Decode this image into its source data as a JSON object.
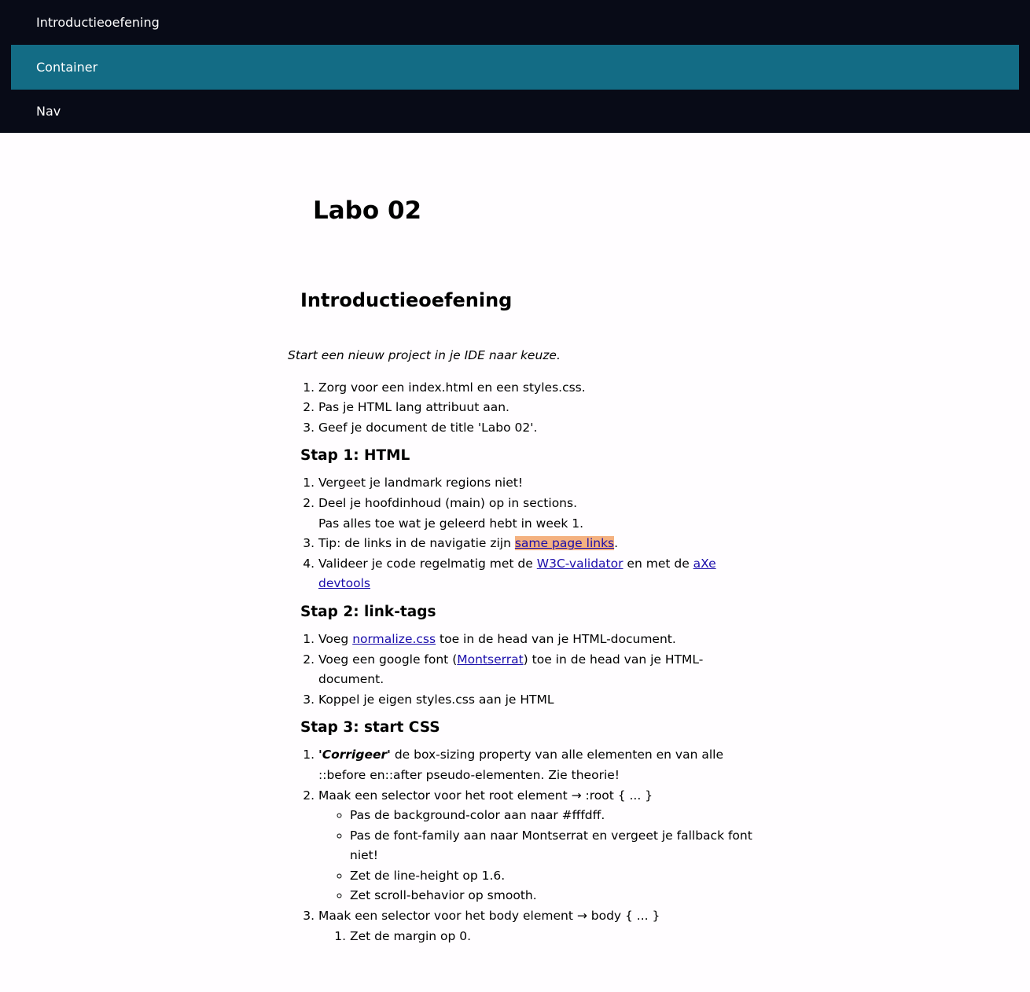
{
  "nav": {
    "items": [
      {
        "label": "Introductieoefening"
      },
      {
        "label": "Container"
      },
      {
        "label": "Nav"
      }
    ]
  },
  "page_title": "Labo 02",
  "section_title": "Introductieoefening",
  "intro": "Start een nieuw project in je IDE naar keuze.",
  "list_intro": [
    "Zorg voor een index.html en een styles.css.",
    "Pas je HTML lang attribuut aan.",
    "Geef je document de title 'Labo 02'."
  ],
  "step1": {
    "title": "Stap 1: HTML",
    "item1": "Vergeet je landmark regions niet!",
    "item2_line1": "Deel je hoofdinhoud (main) op in sections.",
    "item2_line2": "Pas alles toe wat je geleerd hebt in week 1.",
    "item3_prefix": "Tip: de links in de navigatie zijn ",
    "item3_link": "same page links",
    "item3_suffix": ".",
    "item4_prefix": "Valideer je code regelmatig met de ",
    "item4_link1": "W3C-validator",
    "item4_mid": " en met de ",
    "item4_link2": "aXe devtools"
  },
  "step2": {
    "title": "Stap 2: link-tags",
    "item1_prefix": "Voeg ",
    "item1_link": "normalize.css",
    "item1_suffix": " toe in de head van je HTML-document.",
    "item2_prefix": "Voeg een google font (",
    "item2_link": "Montserrat",
    "item2_suffix": ") toe in de head van je HTML-document.",
    "item3": "Koppel je eigen styles.css aan je HTML"
  },
  "step3": {
    "title": "Stap 3: start CSS",
    "item1_strong": "'Corrigeer'",
    "item1_rest": " de box-sizing property van alle elementen en van alle ::before en::after pseudo-elementen. Zie theorie!",
    "item2": "Maak een selector voor het root element → :root { ... }",
    "item2_sub": [
      "Pas de background-color aan naar #fffdff.",
      "Pas de font-family aan naar Montserrat en vergeet je fallback font niet!",
      "Zet de line-height op 1.6.",
      "Zet scroll-behavior op smooth."
    ],
    "item3": "Maak een selector voor het body element → body { ... }",
    "item3_sub": [
      "Zet de margin op 0."
    ]
  },
  "colors": {
    "nav_bg": "#080b17",
    "nav_active": "#136c85",
    "link": "#1a0dab",
    "highlight": "#f4b180",
    "page_bg": "#fffdff"
  }
}
